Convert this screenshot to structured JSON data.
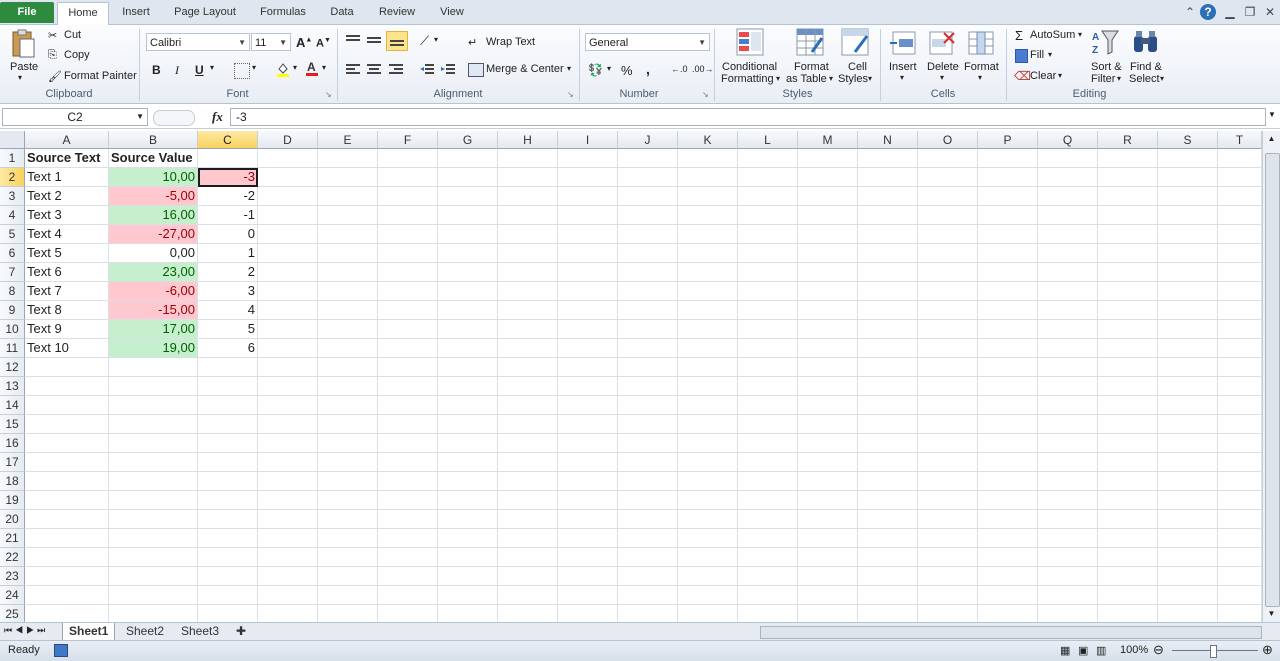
{
  "tabs": [
    "File",
    "Home",
    "Insert",
    "Page Layout",
    "Formulas",
    "Data",
    "Review",
    "View"
  ],
  "clipboard": {
    "paste": "Paste",
    "cut": "Cut",
    "copy": "Copy",
    "format_painter": "Format Painter",
    "group": "Clipboard"
  },
  "font": {
    "name": "Calibri",
    "size": "11",
    "bold": "B",
    "italic": "I",
    "underline": "U",
    "group": "Font"
  },
  "alignment": {
    "wrap": "Wrap Text",
    "merge": "Merge & Center",
    "group": "Alignment"
  },
  "number": {
    "format": "General",
    "percent": "%",
    "comma": ",",
    "group": "Number"
  },
  "styles": {
    "conditional_1": "Conditional",
    "conditional_2": "Formatting",
    "format_table_1": "Format",
    "format_table_2": "as Table",
    "cell_styles_1": "Cell",
    "cell_styles_2": "Styles",
    "group": "Styles"
  },
  "cells": {
    "insert": "Insert",
    "delete": "Delete",
    "format": "Format",
    "group": "Cells"
  },
  "editing": {
    "autosum": "AutoSum",
    "fill": "Fill",
    "clear": "Clear",
    "sort_1": "Sort &",
    "sort_2": "Filter",
    "find_1": "Find &",
    "find_2": "Select",
    "group": "Editing"
  },
  "formula_bar": {
    "name_box": "C2",
    "fx": "fx",
    "value": "-3"
  },
  "columns": [
    "A",
    "B",
    "C",
    "D",
    "E",
    "F",
    "G",
    "H",
    "I",
    "J",
    "K",
    "L",
    "M",
    "N",
    "O",
    "P",
    "Q",
    "R",
    "S",
    "T"
  ],
  "rows": [
    "1",
    "2",
    "3",
    "4",
    "5",
    "6",
    "7",
    "8",
    "9",
    "10",
    "11",
    "12",
    "13",
    "14",
    "15",
    "16",
    "17",
    "18",
    "19",
    "20",
    "21",
    "22",
    "23",
    "24",
    "25"
  ],
  "data": [
    [
      "Source Text",
      "Source Value",
      ""
    ],
    [
      "Text 1",
      "10,00",
      "-3"
    ],
    [
      "Text 2",
      "-5,00",
      "-2"
    ],
    [
      "Text 3",
      "16,00",
      "-1"
    ],
    [
      "Text 4",
      "-27,00",
      "0"
    ],
    [
      "Text 5",
      "0,00",
      "1"
    ],
    [
      "Text 6",
      "23,00",
      "2"
    ],
    [
      "Text 7",
      "-6,00",
      "3"
    ],
    [
      "Text 8",
      "-15,00",
      "4"
    ],
    [
      "Text 9",
      "17,00",
      "5"
    ],
    [
      "Text 10",
      "19,00",
      "6"
    ]
  ],
  "b_fill": [
    "",
    "green",
    "red",
    "green",
    "red",
    "",
    "green",
    "red",
    "red",
    "green",
    "green"
  ],
  "sheets": [
    "Sheet1",
    "Sheet2",
    "Sheet3"
  ],
  "status": {
    "ready": "Ready",
    "zoom": "100%"
  }
}
